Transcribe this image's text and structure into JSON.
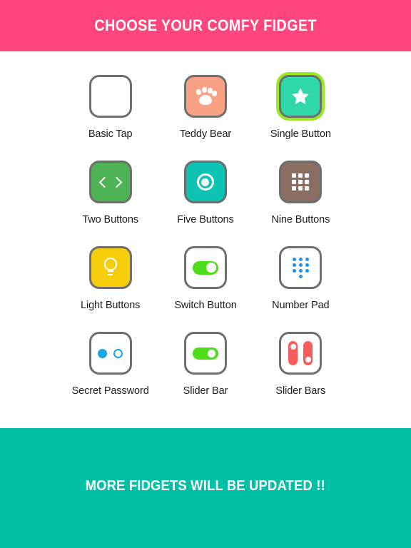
{
  "header": {
    "title": "CHOOSE YOUR COMFY FIDGET",
    "background_color": "#ff457e",
    "text_color": "#ffffff"
  },
  "footer": {
    "text": "MORE FIDGETS WILL BE UPDATED !!",
    "background_color": "#01bfa5",
    "text_color": "#ffffff"
  },
  "grid": {
    "columns": 3,
    "items": [
      {
        "label": "Basic Tap",
        "icon": "empty-square-icon",
        "tile_color": "#ffffff",
        "border_color": "#6e6e6e",
        "selected": false
      },
      {
        "label": "Teddy Bear",
        "icon": "paw-print-icon",
        "tile_color": "#f8a184",
        "border_color": "#6e6e6e",
        "icon_color": "#ffffff",
        "selected": false
      },
      {
        "label": "Single Button",
        "icon": "star-icon",
        "tile_color": "#2fd8ab",
        "border_color": "#6e6e6e",
        "icon_color": "#ffffff",
        "glow_color": "#9ae62a",
        "selected": true
      },
      {
        "label": "Two Buttons",
        "icon": "left-right-chevrons-icon",
        "tile_color": "#4eb354",
        "border_color": "#6e6e6e",
        "icon_color": "#ffffff",
        "selected": false
      },
      {
        "label": "Five Buttons",
        "icon": "target-ring-icon",
        "tile_color": "#0cc3b4",
        "border_color": "#6e6e6e",
        "icon_color": "#ffffff",
        "selected": false
      },
      {
        "label": "Nine Buttons",
        "icon": "grid-3x3-icon",
        "tile_color": "#8a6e62",
        "border_color": "#6e6e6e",
        "icon_color": "#ffffff",
        "selected": false
      },
      {
        "label": "Light Buttons",
        "icon": "light-bulb-icon",
        "tile_color": "#f5cd0a",
        "border_color": "#6e6e6e",
        "icon_color": "#ffffff",
        "selected": false
      },
      {
        "label": "Switch Button",
        "icon": "toggle-switch-icon",
        "tile_color": "#ffffff",
        "border_color": "#6e6e6e",
        "icon_color": "#4fdc1b",
        "selected": false
      },
      {
        "label": "Number Pad",
        "icon": "number-pad-dots-icon",
        "tile_color": "#ffffff",
        "border_color": "#6e6e6e",
        "icon_color": "#1e90e8",
        "selected": false
      },
      {
        "label": "Secret Password",
        "icon": "password-dots-icon",
        "tile_color": "#ffffff",
        "border_color": "#6e6e6e",
        "icon_color": "#18a3ea",
        "selected": false
      },
      {
        "label": "Slider Bar",
        "icon": "horizontal-slider-icon",
        "tile_color": "#ffffff",
        "border_color": "#6e6e6e",
        "icon_color": "#4fdc1b",
        "selected": false
      },
      {
        "label": "Slider Bars",
        "icon": "vertical-sliders-icon",
        "tile_color": "#ffffff",
        "border_color": "#6e6e6e",
        "icon_color": "#fb5b5b",
        "selected": false
      }
    ]
  }
}
